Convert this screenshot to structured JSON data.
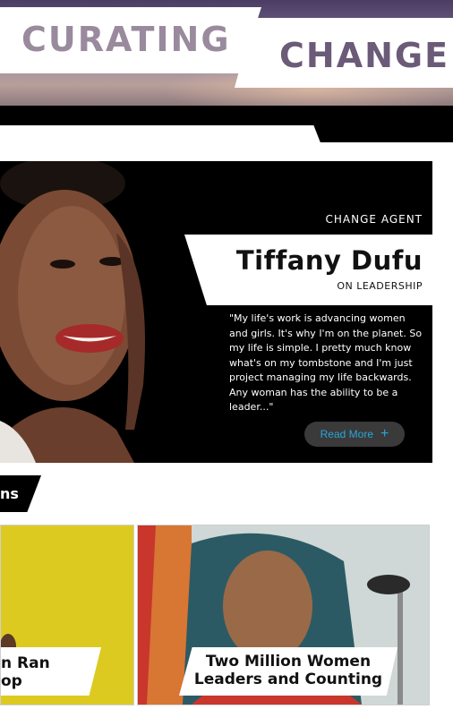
{
  "banner": {
    "word_left": "CURATING",
    "word_right": "CHANGE"
  },
  "feature": {
    "label": "CHANGE AGENT",
    "name": "Tiffany Dufu",
    "topic": "ON LEADERSHIP",
    "quote": "\"My life's work is advancing women and girls. It's why I'm on the planet. So my life is simple. I pretty much know what's on my tombstone and I'm just project managing my life backwards. Any woman has the ability to be a leader...\"",
    "read_more_label": "Read More",
    "read_more_icon": "plus-icon"
  },
  "section": {
    "tab_label": "ns"
  },
  "cards": [
    {
      "caption_line1": "n Ran",
      "caption_line2": "op"
    },
    {
      "caption_line1": "Two Million Women",
      "caption_line2": "Leaders and Counting"
    }
  ],
  "colors": {
    "accent": "#2aa6d6",
    "black": "#000000",
    "card_yellow": "#d8c418"
  }
}
